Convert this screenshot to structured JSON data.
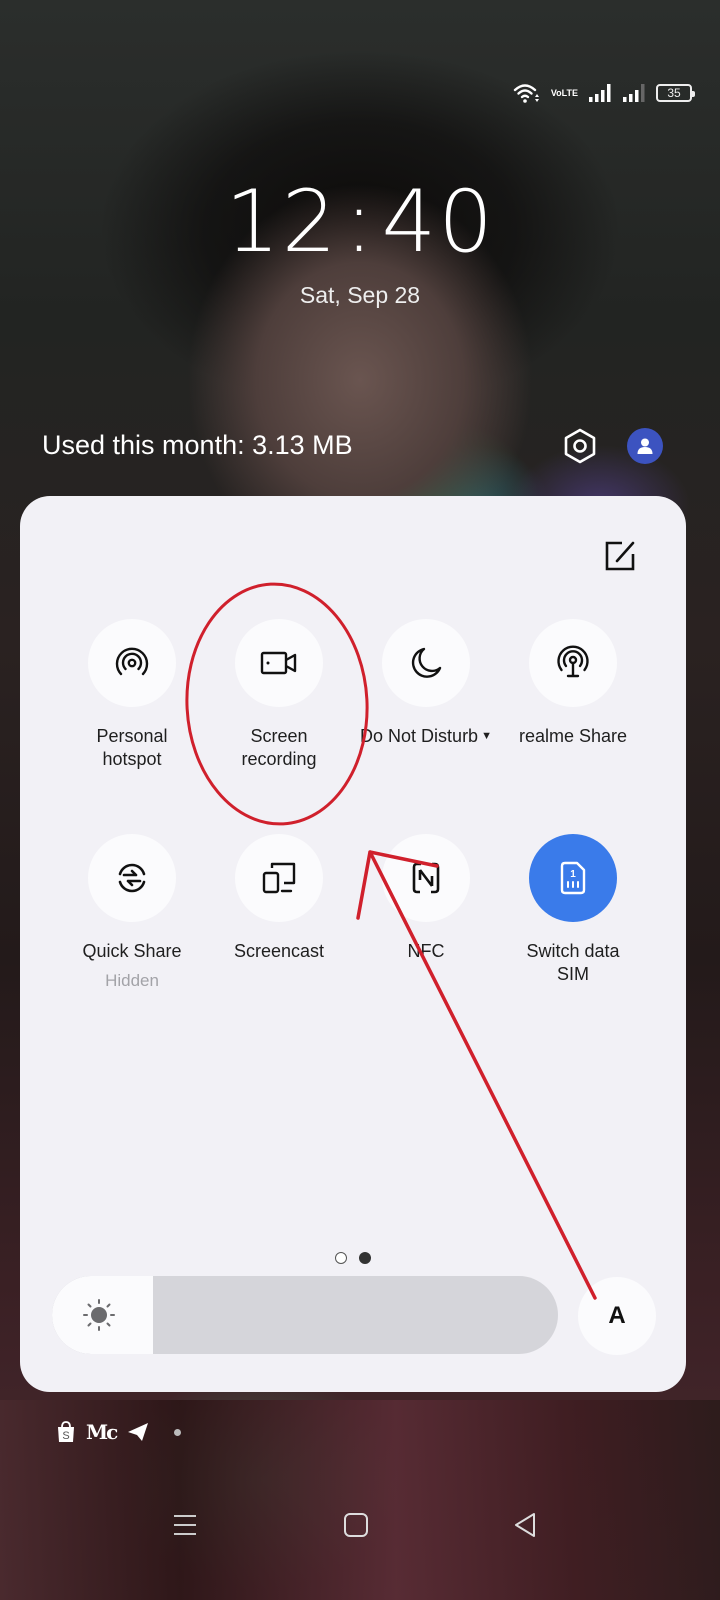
{
  "status_bar": {
    "wifi_icon": "wifi-icon",
    "volte_label_top": "Vo",
    "volte_label_bottom": "LTE",
    "signal_icons": [
      "signal-sim1-icon",
      "signal-sim2-icon"
    ],
    "battery_level": "35"
  },
  "lockscreen": {
    "clock_hours": "12",
    "clock_separator": ":",
    "clock_minutes": "40",
    "date": "Sat, Sep 28"
  },
  "data_usage": {
    "label": "Used this month: 3.13 MB"
  },
  "header_icons": {
    "settings": "settings-icon",
    "user": "user-icon"
  },
  "quick_settings": {
    "edit_icon": "edit-icon",
    "tiles": [
      {
        "label": "Personal\nhotspot",
        "icon": "hotspot-icon",
        "active": false
      },
      {
        "label": "Screen\nrecording",
        "icon": "screen-record-icon",
        "active": false
      },
      {
        "label": "Do Not Disturb",
        "icon": "moon-icon",
        "active": false,
        "has_dropdown": true
      },
      {
        "label": "realme Share",
        "icon": "realme-share-icon",
        "active": false
      },
      {
        "label": "Quick Share",
        "sublabel": "Hidden",
        "icon": "quick-share-icon",
        "active": false
      },
      {
        "label": "Screencast",
        "icon": "screencast-icon",
        "active": false
      },
      {
        "label": "NFC",
        "icon": "nfc-icon",
        "active": false
      },
      {
        "label": "Switch data\nSIM",
        "icon": "sim-icon",
        "active": true,
        "sim_number": "1"
      }
    ],
    "page_indicator": {
      "total": 2,
      "current": 2
    },
    "brightness": {
      "level_percent": 20,
      "icon": "brightness-icon"
    },
    "auto_brightness_label": "A"
  },
  "notification_icons": {
    "items": [
      "shopee-icon",
      "medium-icon",
      "telegram-icon",
      "more-dot-icon"
    ],
    "medium_text": "Mc"
  },
  "nav_bar": {
    "recents": "recents-icon",
    "home": "home-icon",
    "back": "back-icon"
  },
  "annotation": {
    "color": "#d0202c",
    "highlights": "Screen recording",
    "type": "red-ellipse-and-arrow"
  }
}
